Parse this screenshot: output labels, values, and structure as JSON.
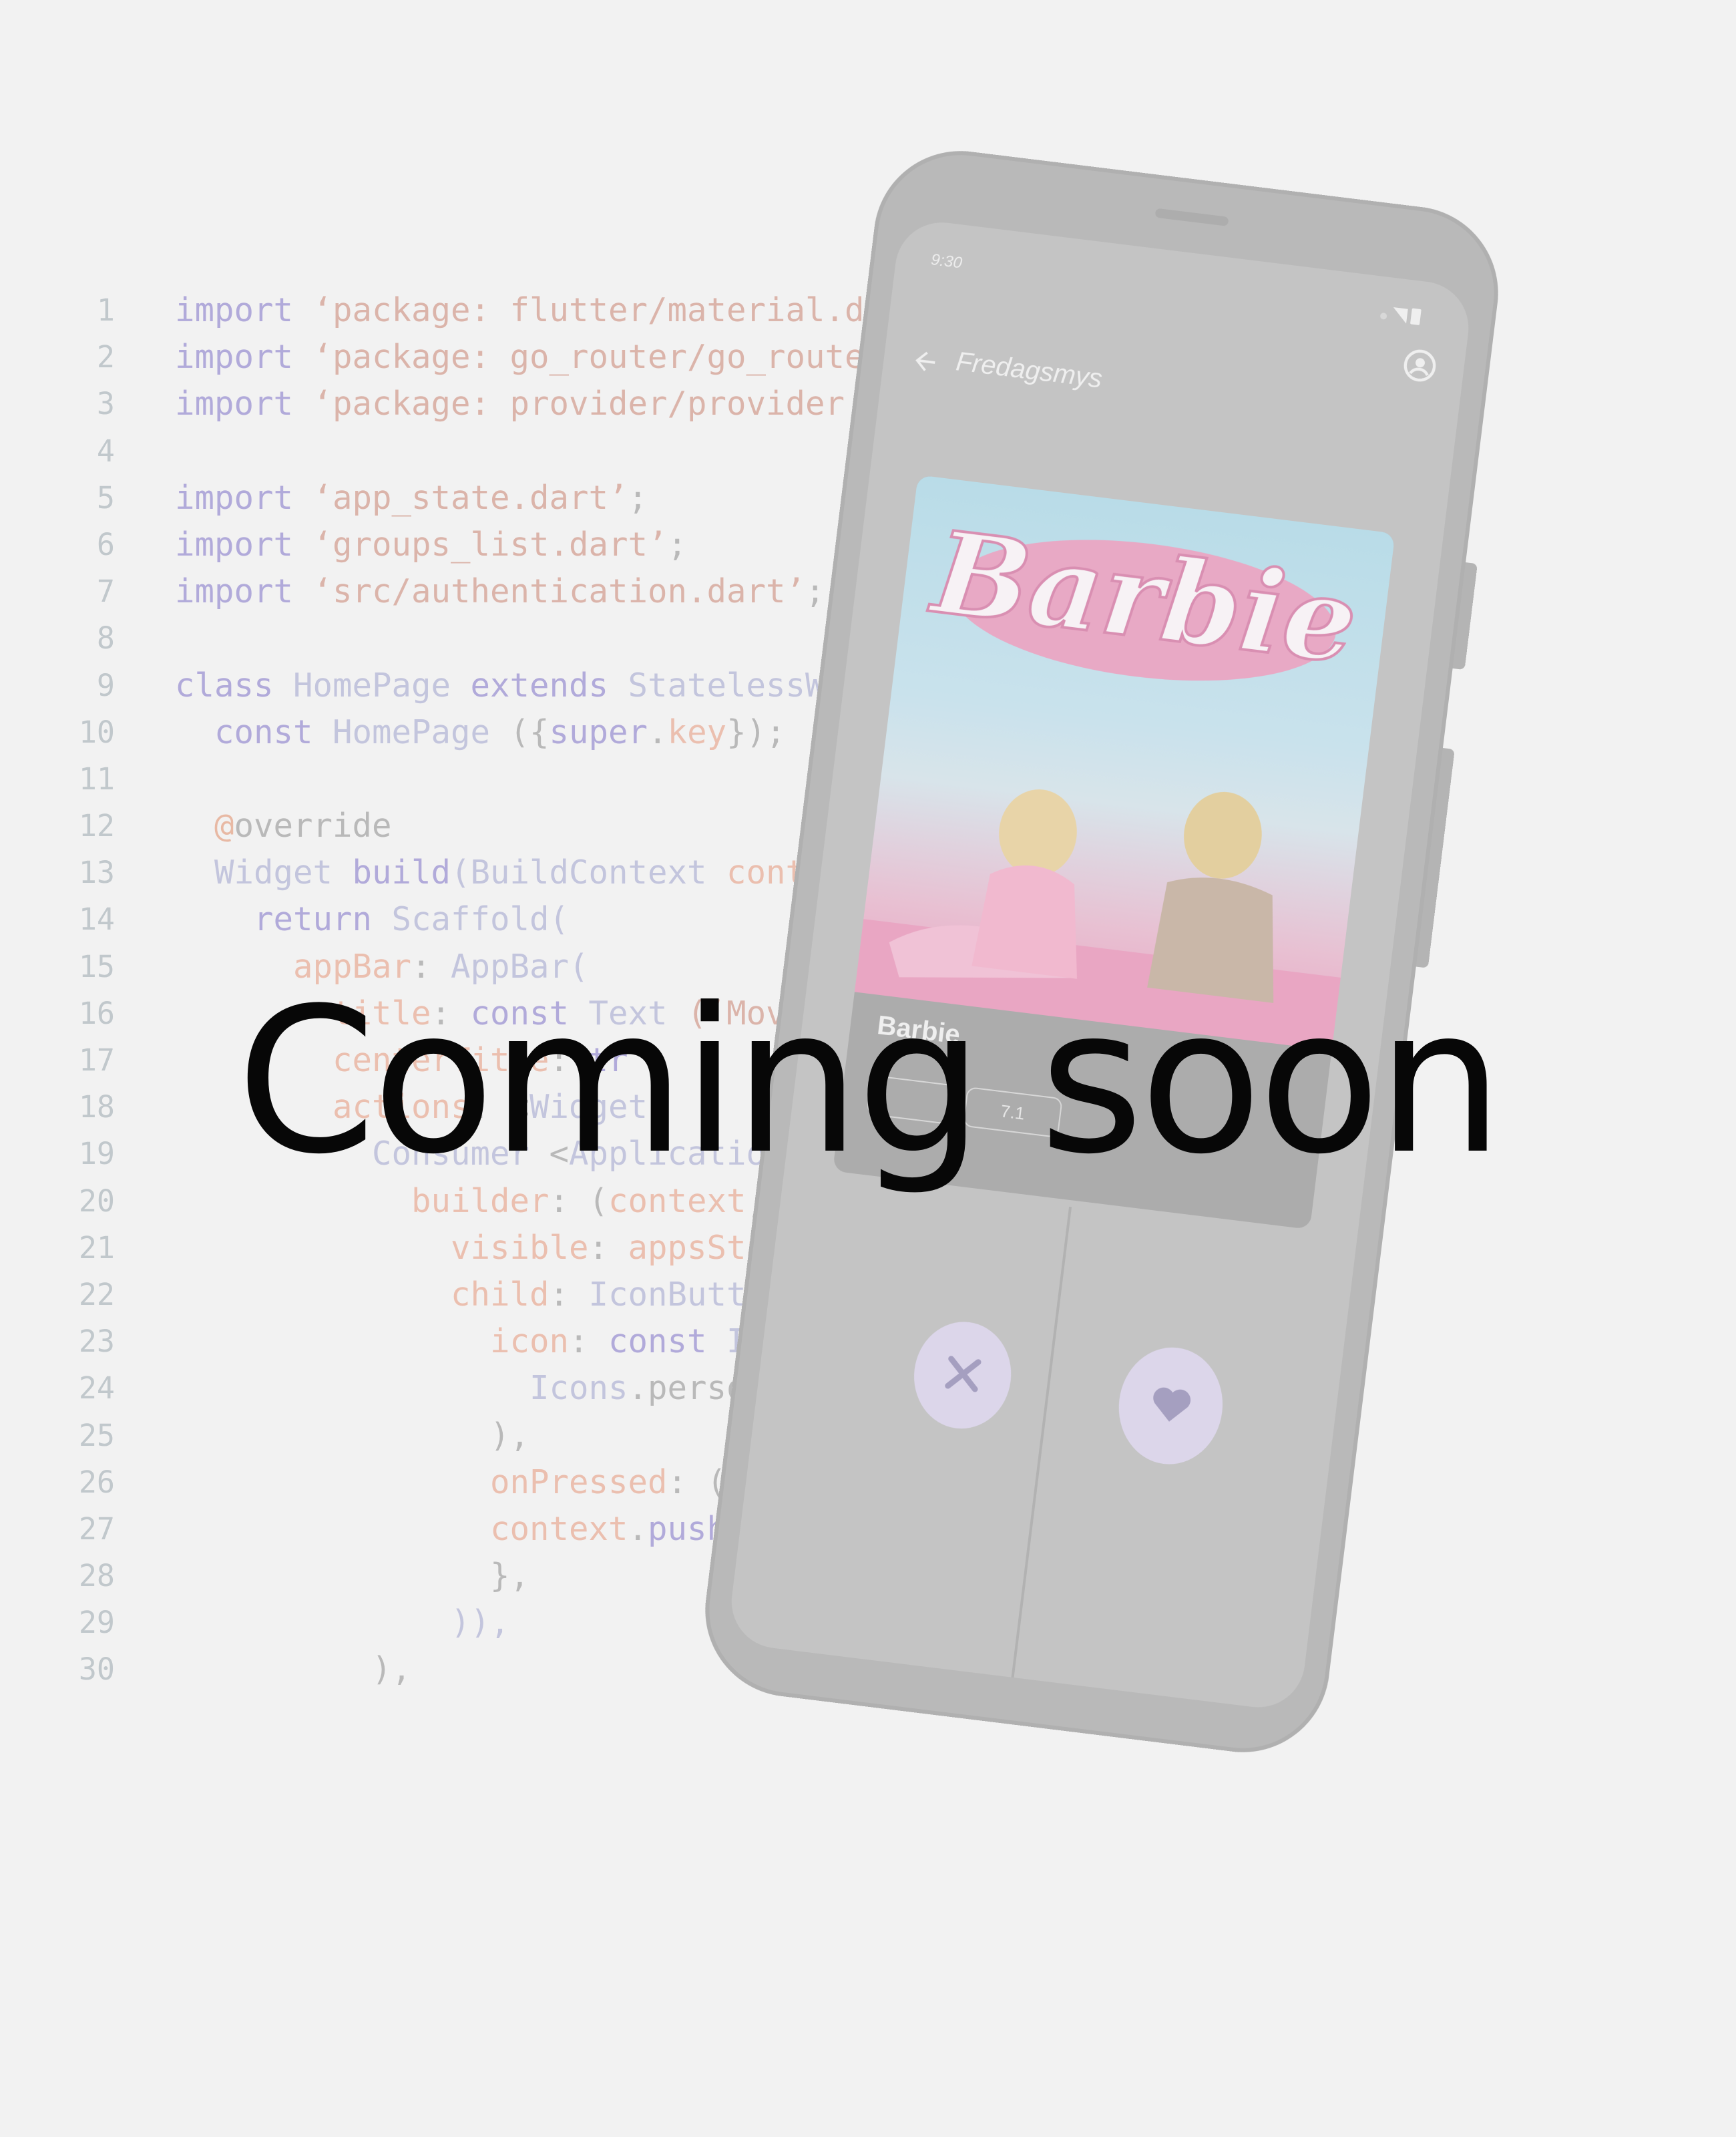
{
  "code_lines": [
    {
      "n": "1",
      "parts": [
        {
          "t": "import ",
          "c": "kw"
        },
        {
          "t": "‘package: flutter/material.d",
          "c": "str"
        }
      ]
    },
    {
      "n": "2",
      "parts": [
        {
          "t": "import ",
          "c": "kw"
        },
        {
          "t": "‘package: go_router/go_route",
          "c": "str"
        }
      ]
    },
    {
      "n": "3",
      "parts": [
        {
          "t": "import ",
          "c": "kw"
        },
        {
          "t": "‘package: provider/provider.",
          "c": "str"
        }
      ]
    },
    {
      "n": "4",
      "parts": []
    },
    {
      "n": "5",
      "parts": [
        {
          "t": "import ",
          "c": "kw"
        },
        {
          "t": "‘app_state.dart’",
          "c": "str"
        },
        {
          "t": ";",
          "c": "pun"
        }
      ]
    },
    {
      "n": "6",
      "parts": [
        {
          "t": "import ",
          "c": "kw"
        },
        {
          "t": "‘groups_list.dart’",
          "c": "str"
        },
        {
          "t": ";",
          "c": "pun"
        }
      ]
    },
    {
      "n": "7",
      "parts": [
        {
          "t": "import ",
          "c": "kw"
        },
        {
          "t": "‘src/authentication.dart’",
          "c": "str"
        },
        {
          "t": ";",
          "c": "pun"
        }
      ]
    },
    {
      "n": "8",
      "parts": []
    },
    {
      "n": "9",
      "parts": [
        {
          "t": "class ",
          "c": "kw"
        },
        {
          "t": "HomePage ",
          "c": "cls"
        },
        {
          "t": "extends ",
          "c": "kw"
        },
        {
          "t": "StatelessW",
          "c": "cls"
        }
      ]
    },
    {
      "n": "10",
      "parts": [
        {
          "t": "  const ",
          "c": "kw"
        },
        {
          "t": "HomePage ",
          "c": "cls"
        },
        {
          "t": "({",
          "c": "pun"
        },
        {
          "t": "super",
          "c": "kw"
        },
        {
          "t": ".",
          "c": "pun"
        },
        {
          "t": "key",
          "c": "prop"
        },
        {
          "t": "});",
          "c": "pun"
        }
      ]
    },
    {
      "n": "11",
      "parts": []
    },
    {
      "n": "12",
      "parts": [
        {
          "t": "  @",
          "c": "ann"
        },
        {
          "t": "override",
          "c": "pun"
        }
      ]
    },
    {
      "n": "13",
      "parts": [
        {
          "t": "  Widget ",
          "c": "cls"
        },
        {
          "t": "build",
          "c": "kw"
        },
        {
          "t": "(BuildContext ",
          "c": "cls"
        },
        {
          "t": "cont",
          "c": "prop"
        }
      ]
    },
    {
      "n": "14",
      "parts": [
        {
          "t": "    return ",
          "c": "kw"
        },
        {
          "t": "Scaffold(",
          "c": "cls"
        }
      ]
    },
    {
      "n": "15",
      "parts": [
        {
          "t": "      appBar",
          "c": "prop"
        },
        {
          "t": ": ",
          "c": "pun"
        },
        {
          "t": "AppBar(",
          "c": "cls"
        }
      ]
    },
    {
      "n": "16",
      "parts": [
        {
          "t": "        title",
          "c": "prop"
        },
        {
          "t": ": ",
          "c": "pun"
        },
        {
          "t": "const ",
          "c": "kw"
        },
        {
          "t": "Text ",
          "c": "cls"
        },
        {
          "t": "(‘Movi",
          "c": "str"
        }
      ]
    },
    {
      "n": "17",
      "parts": [
        {
          "t": "        centerTitle",
          "c": "prop"
        },
        {
          "t": ": ",
          "c": "pun"
        },
        {
          "t": "tr",
          "c": "kw"
        }
      ]
    },
    {
      "n": "18",
      "parts": [
        {
          "t": "        actions",
          "c": "prop"
        },
        {
          "t": ": <",
          "c": "pun"
        },
        {
          "t": "Widget",
          "c": "cls"
        }
      ]
    },
    {
      "n": "19",
      "parts": [
        {
          "t": "          Consumer ",
          "c": "cls"
        },
        {
          "t": "<",
          "c": "pun"
        },
        {
          "t": "Application",
          "c": "cls"
        }
      ]
    },
    {
      "n": "20",
      "parts": [
        {
          "t": "            builder",
          "c": "prop"
        },
        {
          "t": ": (",
          "c": "pun"
        },
        {
          "t": "context",
          "c": "prop"
        },
        {
          "t": ",",
          "c": "pun"
        }
      ]
    },
    {
      "n": "21",
      "parts": [
        {
          "t": "              visible",
          "c": "prop"
        },
        {
          "t": ": ",
          "c": "pun"
        },
        {
          "t": "appsSta",
          "c": "prop"
        }
      ]
    },
    {
      "n": "22",
      "parts": [
        {
          "t": "              child",
          "c": "prop"
        },
        {
          "t": ": ",
          "c": "pun"
        },
        {
          "t": "IconButto",
          "c": "cls"
        }
      ]
    },
    {
      "n": "23",
      "parts": [
        {
          "t": "                icon",
          "c": "prop"
        },
        {
          "t": ": ",
          "c": "pun"
        },
        {
          "t": "const ",
          "c": "kw"
        },
        {
          "t": "Ic",
          "c": "cls"
        }
      ]
    },
    {
      "n": "24",
      "parts": [
        {
          "t": "                  Icons",
          "c": "cls"
        },
        {
          "t": ".person",
          "c": "pun"
        }
      ]
    },
    {
      "n": "25",
      "parts": [
        {
          "t": "                ),",
          "c": "pun"
        }
      ]
    },
    {
      "n": "26",
      "parts": [
        {
          "t": "                onPressed",
          "c": "prop"
        },
        {
          "t": ": ()",
          "c": "pun"
        }
      ]
    },
    {
      "n": "27",
      "parts": [
        {
          "t": "                context",
          "c": "prop"
        },
        {
          "t": ".",
          "c": "pun"
        },
        {
          "t": "push(",
          "c": "kw"
        }
      ]
    },
    {
      "n": "28",
      "parts": [
        {
          "t": "                },",
          "c": "pun"
        }
      ]
    },
    {
      "n": "29",
      "parts": [
        {
          "t": "              )),",
          "c": "cls"
        }
      ]
    },
    {
      "n": "30",
      "parts": [
        {
          "t": "          ),",
          "c": "pun"
        }
      ]
    }
  ],
  "phone": {
    "status_time": "9:30",
    "appbar_title": "Fredagsmys",
    "poster_logo_text": "Barbie",
    "card_title": "Barbie",
    "chips": [
      "",
      "7.1"
    ],
    "icons": {
      "back": "arrow-back-icon",
      "account": "account-circle-icon",
      "dislike": "close-icon",
      "like": "heart-icon",
      "signal": "signal-icon",
      "battery": "battery-icon"
    }
  },
  "headline": "Coming soon",
  "colors": {
    "background": "#f2f2f2",
    "headline": "#070707",
    "phone_body": "#b9b9b9",
    "action_button": "#dcd6ea",
    "poster_sky": "#b9dce8",
    "poster_pink": "#e7a6c3"
  }
}
